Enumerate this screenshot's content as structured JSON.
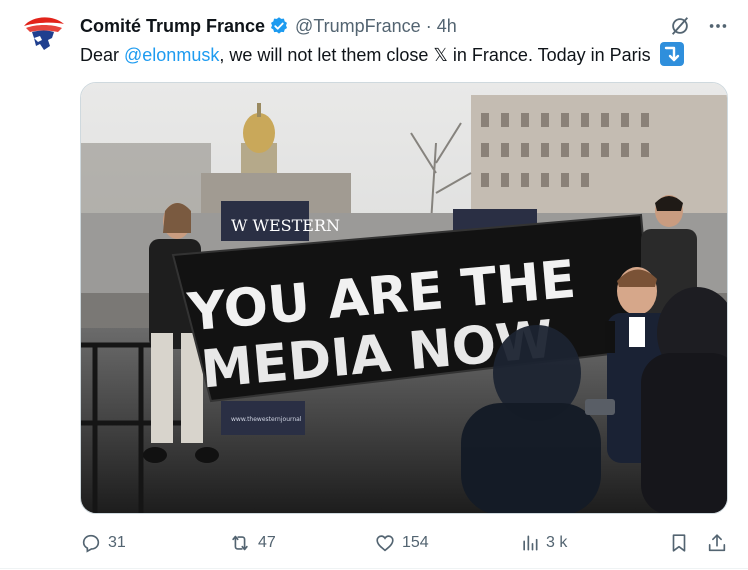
{
  "tweet": {
    "author_name": "Comité Trump France",
    "handle": "@TrumpFrance",
    "separator": "·",
    "time": "4h",
    "text_before": "Dear ",
    "mention": "@elonmusk",
    "text_after": ", we will not let them close 𝕏 in France. Today in Paris",
    "emoji": "right-arrow-curving-down-emoji"
  },
  "media": {
    "banner_line1": "YOU ARE THE",
    "banner_line2": "MEDIA NOW",
    "sign_left": "W WESTERN",
    "sign_small": "www.thewesternjournal"
  },
  "actions": {
    "reply_count": "31",
    "retweet_count": "47",
    "like_count": "154",
    "views_count": "3 k"
  },
  "colors": {
    "accent": "#1d9bf0",
    "muted": "#536471",
    "verified": "#1d9bf0",
    "logo_red": "#e2231a",
    "logo_blue": "#1f3f8f"
  },
  "icons": [
    "verified-badge-icon",
    "grok-slash-icon",
    "more-icon",
    "reply-icon",
    "retweet-icon",
    "like-icon",
    "views-icon",
    "bookmark-icon",
    "share-icon"
  ]
}
